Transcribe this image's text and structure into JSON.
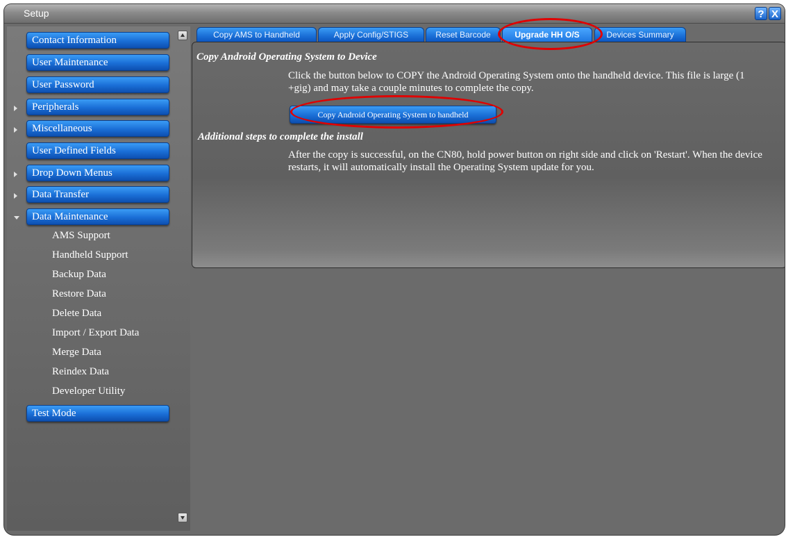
{
  "window": {
    "title": "Setup"
  },
  "titlebar": {
    "help_icon": "question-mark-icon",
    "help_glyph": "?",
    "close_icon": "close-icon",
    "close_glyph": "X"
  },
  "sidebar": {
    "items": [
      {
        "label": "Contact Information",
        "expandable": false
      },
      {
        "label": "User Maintenance",
        "expandable": false
      },
      {
        "label": "User Password",
        "expandable": false
      },
      {
        "label": "Peripherals",
        "expandable": true,
        "expanded": false
      },
      {
        "label": "Miscellaneous",
        "expandable": true,
        "expanded": false
      },
      {
        "label": "User Defined Fields",
        "expandable": false
      },
      {
        "label": "Drop Down Menus",
        "expandable": true,
        "expanded": false
      },
      {
        "label": "Data Transfer",
        "expandable": true,
        "expanded": false
      },
      {
        "label": "Data Maintenance",
        "expandable": true,
        "expanded": true
      },
      {
        "label": "Test Mode",
        "expandable": false
      }
    ],
    "sub_items": [
      "AMS Support",
      "Handheld Support",
      "Backup Data",
      "Restore Data",
      "Delete Data",
      "Import / Export Data",
      "Merge Data",
      "Reindex Data",
      "Developer Utility"
    ]
  },
  "tabs": [
    {
      "label": "Copy AMS to Handheld",
      "active": false
    },
    {
      "label": "Apply Config/STIGS",
      "active": false
    },
    {
      "label": "Reset Barcode",
      "active": false
    },
    {
      "label": "Upgrade HH O/S",
      "active": true
    },
    {
      "label": "Devices Summary",
      "active": false
    }
  ],
  "content": {
    "section1_title": "Copy Android Operating System to Device",
    "section1_text_line1": "Click the button below to COPY the Android Operating System onto the handheld device. This file is large (1",
    "section1_text_line2": "+gig) and may take a couple minutes to complete the copy.",
    "copy_button_label": "Copy Android Operating System to handheld",
    "section2_title": "Additional steps to complete the install",
    "section2_text_line1": "After the copy is successful, on the CN80, hold power button on right side and click on 'Restart'. When the device",
    "section2_text_line2": "restarts, it will automatically install the Operating System update for you."
  },
  "annotations": {
    "highlight_color": "#e00000"
  },
  "colors": {
    "button_blue": "#1a6ed6",
    "background_gray": "#6b6b6b"
  }
}
